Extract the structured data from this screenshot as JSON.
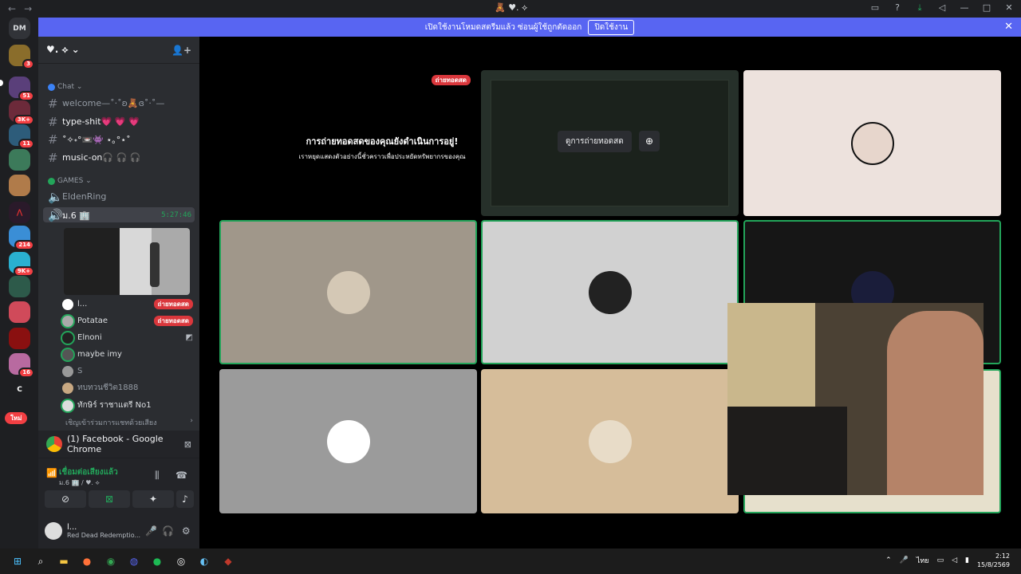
{
  "window": {
    "title": "🧸 ♥︎. ⟡",
    "nav_back": "←",
    "nav_fwd": "→"
  },
  "banner": {
    "text": "เปิดใช้งานโหมดสตรีมแล้ว ซ่อนผู้ใช้ถูกตัดออก",
    "button": "ปิดใช้งาน",
    "accent": "#5865f2"
  },
  "guilds": {
    "dm_label": "DM",
    "new_label": "ใหม่",
    "items": [
      {
        "badge": "3"
      },
      {
        "badge": "51"
      },
      {
        "badge": "3K+"
      },
      {
        "badge": "11"
      },
      {
        "badge": ""
      },
      {
        "badge": ""
      },
      {
        "badge": ""
      },
      {
        "badge": "214"
      },
      {
        "badge": "9K+"
      },
      {
        "badge": ""
      },
      {
        "badge": ""
      },
      {
        "badge": ""
      },
      {
        "badge": "16"
      },
      {
        "badge": "",
        "letter": "C"
      }
    ]
  },
  "server": {
    "name": "♥︎. ⟡ ⌄"
  },
  "categories": {
    "chat": "Chat ⌄",
    "games": "GAMES ⌄"
  },
  "channels": [
    {
      "name": "welcome—˚·˚ʚ🧸ɞ˚·˚—"
    },
    {
      "name": "type-shit💗 💗 💗"
    },
    {
      "name": "˚✧˖°📼👾 ⋆｡°⋆˚"
    },
    {
      "name": "music-on🎧 🎧 🎧"
    }
  ],
  "voice_channels": {
    "eldenring": "EldenRing",
    "active": "ม.6 🏢",
    "timer": "5:27:46"
  },
  "members": [
    {
      "name": "l...",
      "live": "ถ่ายทอดสด"
    },
    {
      "name": "Potatae",
      "live": "ถ่ายทอดสด"
    },
    {
      "name": "Elnoni",
      "live": ""
    },
    {
      "name": "maybe imy",
      "live": ""
    },
    {
      "name": "S",
      "live": ""
    },
    {
      "name": "ทบทวนชีวิต1888",
      "live": ""
    },
    {
      "name": "ทักษิร์ ราชาแตรี No1",
      "live": ""
    }
  ],
  "invite": {
    "text": "เชิญเข้าร่วมการแชทด้วยเสียง",
    "arrow": "›"
  },
  "stream_card": {
    "title": "(1) Facebook - Google Chrome"
  },
  "voice_panel": {
    "status": "เชื่อมต่อเสียงแล้ว",
    "channel": "ม.6 🏢 / ♥︎. ⟡"
  },
  "user_panel": {
    "name": "l...",
    "activity": "Red Dead Redemptio..."
  },
  "stage": {
    "paused_title": "การถ่ายทอดสดของคุณยังดำเนินการอยู่!",
    "paused_sub": "เราหยุดแสดงตัวอย่างนี้ชั่วคราวเพื่อประหยัดทรัพยากรของคุณ",
    "live_tag": "ถ่ายทอดสด",
    "watch_button": "ดูการถ่ายทอดสด"
  },
  "taskbar": {
    "lang": "ไทย",
    "time": "2:12",
    "date": "15/8/2569"
  }
}
